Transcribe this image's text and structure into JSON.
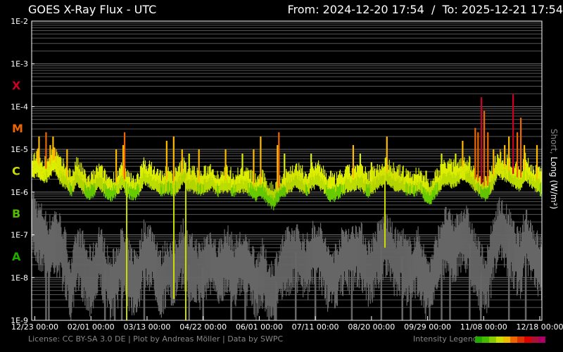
{
  "header": {
    "title": "GOES X-Ray Flux - UTC",
    "range": "From: 2024-12-20 17:54  /  To: 2025-12-21 17:54"
  },
  "footer": {
    "license": "License: CC BY-SA 3.0 DE | Plot by Andreas Möller | Data by SWPC",
    "legend_label": "Intensity Legend",
    "legend_colors": [
      "#22aa00",
      "#44bb00",
      "#88cc00",
      "#ccdd00",
      "#eebb00",
      "#ee6600",
      "#dd3300",
      "#dd0000",
      "#aa1133",
      "#aa0066"
    ]
  },
  "chart_data": {
    "type": "line",
    "title": "GOES X-Ray Flux - UTC",
    "ylabel_short": "Short,",
    "ylabel_long": "Long (W/m²)",
    "yscale": "log",
    "ylim_log10": [
      -9,
      -2
    ],
    "y_ticks": [
      {
        "v": -2,
        "label": "1E-2"
      },
      {
        "v": -3,
        "label": "1E-3"
      },
      {
        "v": -4,
        "label": "1E-4"
      },
      {
        "v": -5,
        "label": "1E-5"
      },
      {
        "v": -6,
        "label": "1E-6"
      },
      {
        "v": -7,
        "label": "1E-7"
      },
      {
        "v": -8,
        "label": "1E-8"
      },
      {
        "v": -9,
        "label": "1E-9"
      }
    ],
    "classes": [
      {
        "label": "X",
        "v": -3.5,
        "color": "#cc0022"
      },
      {
        "label": "M",
        "v": -4.5,
        "color": "#ee6600"
      },
      {
        "label": "C",
        "v": -5.5,
        "color": "#ccdd00"
      },
      {
        "label": "B",
        "v": -6.5,
        "color": "#55bb00"
      },
      {
        "label": "A",
        "v": -7.5,
        "color": "#22aa00"
      }
    ],
    "x_unit": "days since 12/23 00:00",
    "xlim": [
      -2.26,
      361.5
    ],
    "x_ticks": [
      {
        "v": 0,
        "label": "12/23 00:00"
      },
      {
        "v": 40,
        "label": "02/01 00:00"
      },
      {
        "v": 80,
        "label": "03/13 00:00"
      },
      {
        "v": 120,
        "label": "04/22 00:00"
      },
      {
        "v": 160,
        "label": "06/01 00:00"
      },
      {
        "v": 200,
        "label": "07/11 00:00"
      },
      {
        "v": 240,
        "label": "08/20 00:00"
      },
      {
        "v": 280,
        "label": "09/29 00:00"
      },
      {
        "v": 320,
        "label": "11/08 00:00"
      },
      {
        "v": 360,
        "label": "12/18 00:00"
      }
    ],
    "sample_start": -2,
    "sample_step_days": 4,
    "series": [
      {
        "name": "Long",
        "log10_values": [
          -5.5,
          -5.4,
          -5.6,
          -5.5,
          -5.3,
          -5.6,
          -5.7,
          -5.9,
          -5.6,
          -5.8,
          -6.0,
          -5.9,
          -5.7,
          -5.9,
          -6.0,
          -5.9,
          -5.7,
          -5.9,
          -6.0,
          -5.9,
          -5.6,
          -5.7,
          -5.8,
          -5.9,
          -5.8,
          -5.9,
          -5.8,
          -5.6,
          -5.8,
          -5.8,
          -5.9,
          -5.8,
          -5.7,
          -5.9,
          -5.8,
          -5.8,
          -5.9,
          -5.8,
          -5.8,
          -5.9,
          -6.0,
          -5.9,
          -6.1,
          -6.2,
          -6.0,
          -5.9,
          -5.8,
          -5.7,
          -5.8,
          -5.9,
          -5.7,
          -5.7,
          -5.8,
          -6.0,
          -6.0,
          -5.9,
          -5.8,
          -5.8,
          -5.7,
          -5.8,
          -5.9,
          -5.8,
          -5.7,
          -5.6,
          -5.7,
          -5.8,
          -5.8,
          -5.9,
          -5.9,
          -5.8,
          -6.0,
          -6.1,
          -5.9,
          -5.7,
          -5.6,
          -5.7,
          -5.6,
          -5.5,
          -5.6,
          -5.8,
          -5.9,
          -6.0,
          -5.8,
          -5.4,
          -5.5,
          -5.6,
          -5.7,
          -5.8,
          -5.5,
          -5.7,
          -5.8,
          -5.9
        ]
      },
      {
        "name": "Short",
        "log10_values": [
          -6.5,
          -6.9,
          -7.0,
          -7.3,
          -7.0,
          -7.2,
          -7.6,
          -8.3,
          -7.5,
          -7.6,
          -8.0,
          -7.9,
          -7.4,
          -7.8,
          -8.2,
          -7.9,
          -7.5,
          -7.8,
          -8.0,
          -7.9,
          -7.3,
          -7.4,
          -7.6,
          -8.1,
          -7.7,
          -7.9,
          -7.6,
          -7.3,
          -7.7,
          -7.7,
          -7.9,
          -7.6,
          -7.5,
          -7.9,
          -7.6,
          -7.5,
          -7.8,
          -7.6,
          -7.7,
          -7.8,
          -8.1,
          -7.8,
          -8.2,
          -8.3,
          -7.9,
          -7.6,
          -7.5,
          -7.4,
          -7.6,
          -7.7,
          -7.4,
          -7.3,
          -7.6,
          -8.0,
          -7.9,
          -7.6,
          -7.4,
          -7.5,
          -7.3,
          -7.5,
          -7.8,
          -7.6,
          -7.3,
          -7.1,
          -7.4,
          -7.6,
          -7.5,
          -7.8,
          -7.7,
          -7.5,
          -8.0,
          -8.2,
          -7.7,
          -7.2,
          -7.0,
          -7.3,
          -7.1,
          -6.9,
          -7.2,
          -7.6,
          -7.9,
          -8.1,
          -7.4,
          -6.8,
          -6.9,
          -7.1,
          -7.4,
          -7.6,
          -7.0,
          -7.3,
          -7.6,
          -7.8
        ]
      }
    ],
    "flares_long_log10": [
      [
        3,
        -4.7
      ],
      [
        8,
        -4.6
      ],
      [
        11,
        -4.9
      ],
      [
        13,
        -4.7
      ],
      [
        23,
        -5.0
      ],
      [
        58,
        -5.0
      ],
      [
        63,
        -4.9
      ],
      [
        64,
        -4.6
      ],
      [
        94,
        -4.8
      ],
      [
        99,
        -4.7
      ],
      [
        105,
        -5.0
      ],
      [
        110,
        -5.1
      ],
      [
        117,
        -5.0
      ],
      [
        136,
        -5.0
      ],
      [
        148,
        -5.1
      ],
      [
        156,
        -5.0
      ],
      [
        161,
        -4.7
      ],
      [
        173,
        -4.9
      ],
      [
        174,
        -4.6
      ],
      [
        178,
        -5.1
      ],
      [
        197,
        -5.1
      ],
      [
        211,
        -5.5
      ],
      [
        223,
        -5.5
      ],
      [
        227,
        -4.9
      ],
      [
        232,
        -5.1
      ],
      [
        240,
        -5.3
      ],
      [
        250,
        -5.2
      ],
      [
        251,
        -4.7
      ],
      [
        266,
        -5.5
      ],
      [
        279,
        -5.5
      ],
      [
        290,
        -5.1
      ],
      [
        292,
        -5.3
      ],
      [
        300,
        -5.1
      ],
      [
        305,
        -4.8
      ],
      [
        314,
        -4.5
      ],
      [
        316,
        -4.6
      ],
      [
        318.4,
        -3.78
      ],
      [
        320.4,
        -4.1
      ],
      [
        323,
        -4.6
      ],
      [
        327,
        -5.0
      ],
      [
        335,
        -4.9
      ],
      [
        338,
        -4.7
      ],
      [
        341,
        -3.71
      ],
      [
        344,
        -4.6
      ],
      [
        346.5,
        -4.26
      ],
      [
        349,
        -4.9
      ],
      [
        358,
        -4.9
      ]
    ],
    "dips_long_log10": [
      [
        65.5,
        -9.0
      ],
      [
        99.1,
        -8.5
      ],
      [
        107.6,
        -9.0
      ],
      [
        249.6,
        -7.3
      ]
    ],
    "dips_short_log10": [
      [
        8,
        -9
      ],
      [
        10,
        -9
      ],
      [
        50,
        -9
      ],
      [
        57,
        -9
      ],
      [
        62,
        -9
      ],
      [
        78,
        -9
      ],
      [
        110,
        -9
      ],
      [
        120,
        -9
      ],
      [
        140,
        -9
      ],
      [
        150,
        -9
      ],
      [
        172,
        -9
      ],
      [
        186,
        -9
      ],
      [
        200,
        -9
      ],
      [
        226,
        -9
      ],
      [
        247,
        -9
      ],
      [
        262,
        -9
      ],
      [
        268,
        -9
      ],
      [
        290,
        -9
      ],
      [
        296,
        -9
      ],
      [
        310,
        -9
      ],
      [
        318,
        -9
      ],
      [
        338,
        -9
      ],
      [
        350,
        -9
      ]
    ]
  }
}
